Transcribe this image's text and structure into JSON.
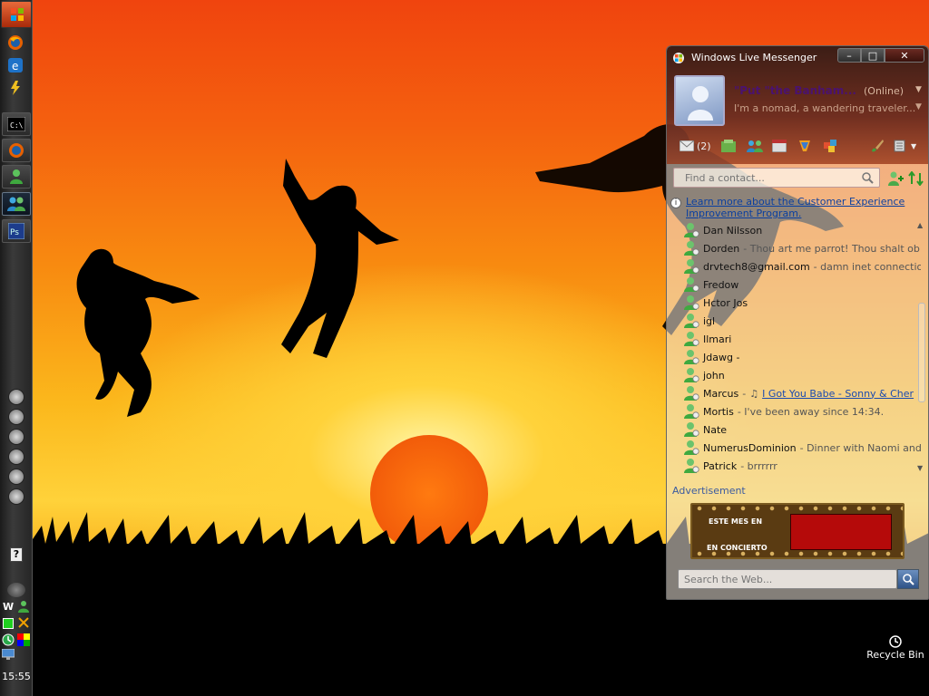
{
  "taskbar": {
    "clock": "15:55",
    "help_label": "?"
  },
  "messenger": {
    "window_title": "Windows Live Messenger",
    "controls": {
      "minimize": "–",
      "maximize": "□",
      "close": "✕"
    },
    "profile": {
      "display_name": "\"Put \"the Banham...",
      "status": "(Online)",
      "personal_message": "I'm a nomad, a wandering traveler..."
    },
    "toolbar": {
      "mail_count": "(2)"
    },
    "search": {
      "placeholder": "Find a contact..."
    },
    "info_bar": {
      "link": "Learn more about the Customer Experience Improvement Program."
    },
    "contacts": [
      {
        "name": "Dan Nilsson",
        "message": ""
      },
      {
        "name": "Dorden",
        "message": "- Thou art me parrot! Thou shalt ob..."
      },
      {
        "name": "drvtech8@gmail.com",
        "message": "- damn inet connectio..."
      },
      {
        "name": "Fredow",
        "message": ""
      },
      {
        "name": "Hctor Jos",
        "message": ""
      },
      {
        "name": "igl",
        "message": ""
      },
      {
        "name": "Ilmari",
        "message": ""
      },
      {
        "name": "Jdawg -",
        "message": ""
      },
      {
        "name": "john",
        "message": ""
      },
      {
        "name": "Marcus",
        "message": "-",
        "song": "I Got You Babe - Sonny & Cher"
      },
      {
        "name": "Mortis",
        "message": "- I've been away since 14:34."
      },
      {
        "name": "Nate",
        "message": ""
      },
      {
        "name": "NumerusDominion",
        "message": "- Dinner with Naomi and t..."
      },
      {
        "name": "Patrick",
        "message": "- brrrrrr"
      }
    ],
    "advertisement": {
      "label": "Advertisement",
      "line1": "ESTE MES EN",
      "line2": "EN CONCIERTO"
    },
    "web_search": {
      "placeholder": "Search the Web..."
    }
  },
  "desktop": {
    "recycle_bin": "Recycle Bin"
  },
  "colors": {
    "display_name": "#4a1270",
    "link": "#0a3fa0",
    "ad_red": "#b50a0a"
  }
}
